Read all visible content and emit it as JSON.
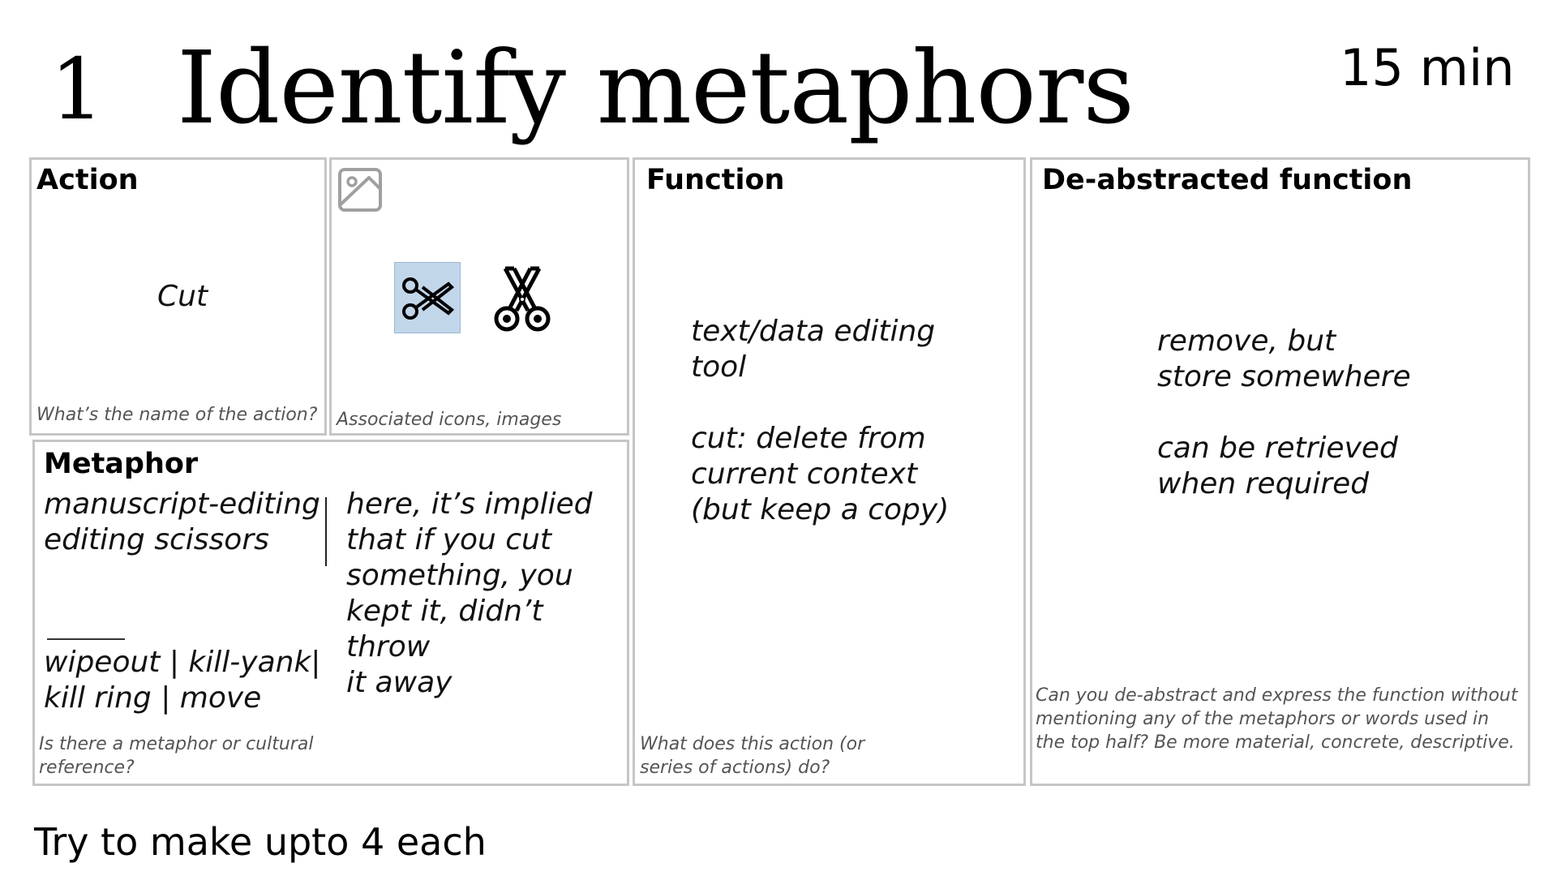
{
  "header": {
    "step_number": "1",
    "title": "Identify metaphors",
    "time": "15 min"
  },
  "action": {
    "title": "Action",
    "value": "Cut",
    "hint": "What’s the name of the action?"
  },
  "icons": {
    "hint": "Associated icons, images",
    "items": [
      "picture-icon",
      "scissors-icon-highlighted",
      "scissors-icon"
    ],
    "highlight_color": "#c2d6ea"
  },
  "metaphor": {
    "title": "Metaphor",
    "left_text": "manuscript-editing\nediting scissors",
    "bottom_text": "wipeout | kill-yank|\nkill ring | move",
    "right_text": "here, it’s implied\nthat if you cut\nsomething, you\nkept it, didn’t throw\nit away",
    "hint": "Is there a metaphor or cultural reference?"
  },
  "function": {
    "title": "Function",
    "text": "text/data editing\ntool\n\ncut: delete from\ncurrent context\n(but keep a copy)",
    "hint": "What does this action (or series of actions) do?"
  },
  "deabstracted": {
    "title": "De-abstracted function",
    "text": "remove, but\nstore somewhere\n\ncan be retrieved\nwhen required",
    "hint": "Can you de-abstract and express the function without mentioning any of the metaphors or words used in the top half? Be more material, concrete, descriptive."
  },
  "footer": {
    "note": "Try to make upto 4 each"
  },
  "colors": {
    "border": "#c6c6c6",
    "hint_text": "#555555"
  }
}
